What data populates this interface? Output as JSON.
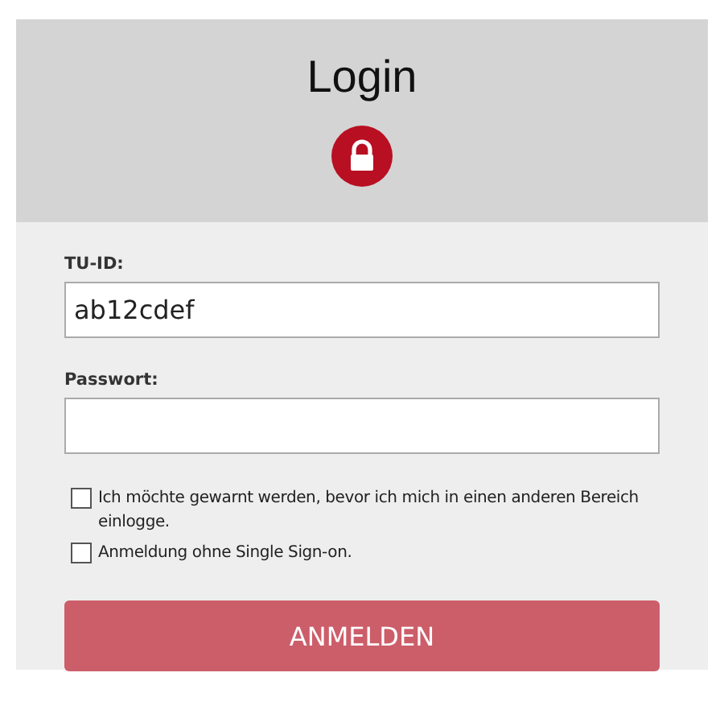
{
  "title": "Login",
  "fields": [
    {
      "label": "TU-ID:",
      "value": "ab12cdef"
    },
    {
      "label": "Passwort:"
    }
  ],
  "options": [
    {
      "label": "Ich möchte gewarnt werden, bevor ich mich in einen anderen Bereich einlogge.",
      "checked": false
    },
    {
      "label": "Anmeldung ohne Single Sign-on.",
      "checked": false
    }
  ],
  "submit": "ANMELDEN"
}
